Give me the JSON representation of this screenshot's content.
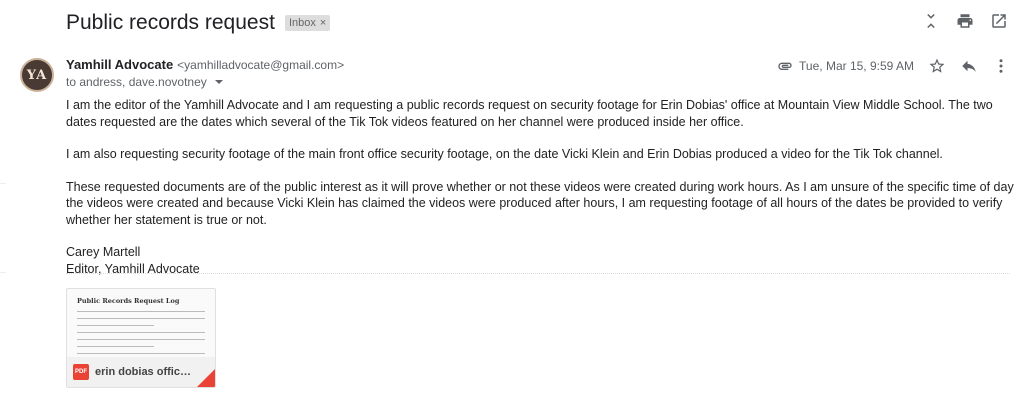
{
  "header": {
    "subject": "Public records request",
    "label": "Inbox",
    "label_close": "×"
  },
  "icons": {
    "expand": "unfold-icon",
    "print": "print-icon",
    "popout": "open-in-new-icon",
    "attachment": "paperclip-icon",
    "star": "star-icon",
    "reply": "reply-icon",
    "more": "more-vert-icon"
  },
  "sender": {
    "avatar_initials": "YA",
    "name": "Yamhill Advocate",
    "email": "<yamhilladvocate@gmail.com>",
    "to": "to andress, dave.novotney",
    "date": "Tue, Mar 15, 9:59 AM"
  },
  "body": {
    "p1": "I am the editor of the Yamhill Advocate and I am requesting a public records request on security footage for Erin Dobias' office at Mountain View Middle School.  The two dates requested are the dates which several of the Tik Tok videos featured on her channel were produced inside her office.",
    "p2": "I am also requesting security footage of the main front office security footage, on the date Vicki Klein and Erin Dobias produced a video for the Tik Tok channel.",
    "p3": "These requested documents are of the public interest as it will prove whether or not these videos were created during work hours. As I am unsure of the specific time of day the videos were created and because Vicki Klein has claimed the videos were produced after hours, I am requesting footage of all hours of the dates be provided to verify whether her statement is true or not.",
    "sig_name": "Carey Martell",
    "sig_title": "Editor, Yamhill Advocate"
  },
  "attachment": {
    "preview_title": "Public Records Request Log",
    "type_label": "PDF",
    "name": "erin dobias office p..."
  },
  "colors": {
    "accent_red": "#ea4335",
    "text_primary": "#202124",
    "text_secondary": "#5f6368"
  }
}
